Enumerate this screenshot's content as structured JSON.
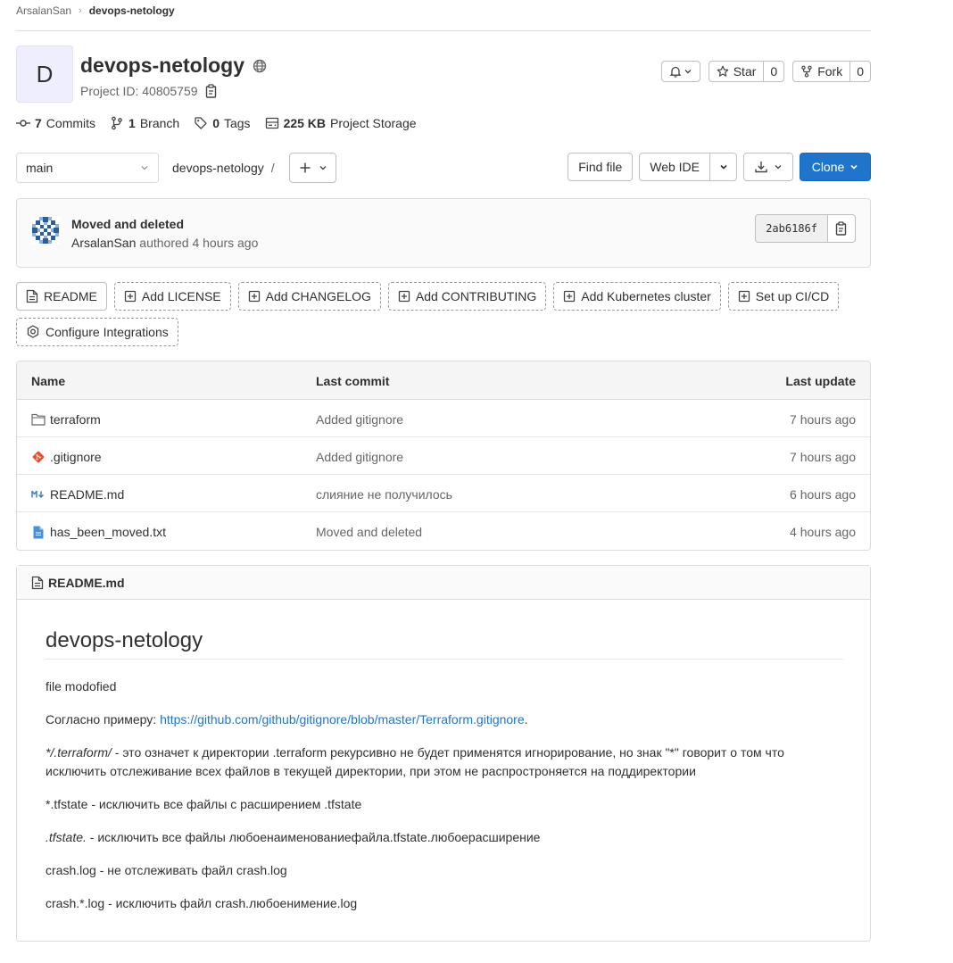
{
  "breadcrumb": {
    "owner": "ArsalanSan",
    "project": "devops-netology"
  },
  "project": {
    "avatar_letter": "D",
    "name": "devops-netology",
    "id_label": "Project ID: 40805759"
  },
  "header_buttons": {
    "star_label": "Star",
    "star_count": "0",
    "fork_label": "Fork",
    "fork_count": "0"
  },
  "stats": {
    "commits_count": "7",
    "commits_label": "Commits",
    "branches_count": "1",
    "branches_label": "Branch",
    "tags_count": "0",
    "tags_label": "Tags",
    "storage_count": "225 KB",
    "storage_label": "Project Storage"
  },
  "toolbar": {
    "branch": "main",
    "path": "devops-netology",
    "path_sep": "/",
    "find_file": "Find file",
    "web_ide": "Web IDE",
    "clone": "Clone"
  },
  "last_commit": {
    "title": "Moved and deleted",
    "author": "ArsalanSan",
    "meta": "authored 4 hours ago",
    "sha": "2ab6186f"
  },
  "quick_actions": [
    "README",
    "Add LICENSE",
    "Add CHANGELOG",
    "Add CONTRIBUTING",
    "Add Kubernetes cluster",
    "Set up CI/CD",
    "Configure Integrations"
  ],
  "table": {
    "headers": {
      "name": "Name",
      "last_commit": "Last commit",
      "last_update": "Last update"
    },
    "rows": [
      {
        "name": "terraform",
        "commit": "Added gitignore",
        "updated": "7 hours ago",
        "icon": "folder-icon"
      },
      {
        "name": ".gitignore",
        "commit": "Added gitignore",
        "updated": "7 hours ago",
        "icon": "git-icon"
      },
      {
        "name": "README.md",
        "commit": "слияние не получилось",
        "updated": "6 hours ago",
        "icon": "markdown-icon"
      },
      {
        "name": "has_been_moved.txt",
        "commit": "Moved and deleted",
        "updated": "4 hours ago",
        "icon": "text-file-icon"
      }
    ]
  },
  "readme": {
    "filename": "README.md",
    "heading": "devops-netology",
    "p1": "file modofied",
    "p2_prefix": "Согласно примеру: ",
    "p2_link": "https://github.com/github/gitignore/blob/master/Terraform.gitignore",
    "p2_suffix": ".",
    "p3_italic": "*/.terraform/",
    "p3_rest": " - это означет к директории .terraform рекурсивно не будет применятся игнорирование, но знак \"*\" говорит о том что исключить отслеживание всех файлов в текущей директории, при этом не распростроняется на поддиректории",
    "p4": "*.tfstate - исключить все файлы с расширением .tfstate",
    "p5_italic": ".tfstate.",
    "p5_rest": " - исключить все файлы любоенаименованиефайла.tfstate.любоерасширение",
    "p6": "crash.log - не отслеживать файл crash.log",
    "p7": "crash.*.log - исключить файл crash.любоенимение.log"
  },
  "colors": {
    "accent": "#1f75cb",
    "border": "#dbdbdb",
    "text": "#303030",
    "muted": "#666666"
  }
}
